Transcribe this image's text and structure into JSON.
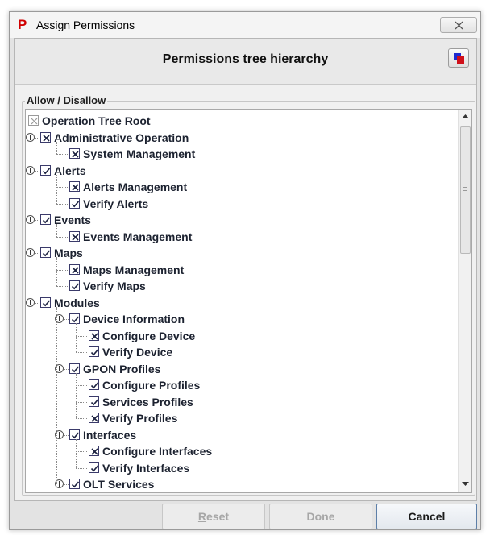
{
  "window": {
    "title": "Assign Permissions",
    "logo_letter": "P",
    "close_icon": "close-x-icon"
  },
  "header": {
    "title": "Permissions tree hierarchy",
    "icon": "windows-switch-icon"
  },
  "group": {
    "legend": "Allow / Disallow"
  },
  "tree": [
    {
      "label": "Operation Tree Root",
      "level": 0,
      "state": "root",
      "expandable": false
    },
    {
      "label": "Administrative Operation",
      "level": 1,
      "state": "x",
      "expandable": true
    },
    {
      "label": "System Management",
      "level": 2,
      "state": "x",
      "expandable": false
    },
    {
      "label": "Alerts",
      "level": 1,
      "state": "check",
      "expandable": true
    },
    {
      "label": "Alerts Management",
      "level": 2,
      "state": "x",
      "expandable": false
    },
    {
      "label": "Verify Alerts",
      "level": 2,
      "state": "check",
      "expandable": false
    },
    {
      "label": "Events",
      "level": 1,
      "state": "check",
      "expandable": true
    },
    {
      "label": "Events Management",
      "level": 2,
      "state": "x",
      "expandable": false
    },
    {
      "label": "Maps",
      "level": 1,
      "state": "check",
      "expandable": true
    },
    {
      "label": "Maps Management",
      "level": 2,
      "state": "x",
      "expandable": false
    },
    {
      "label": "Verify Maps",
      "level": 2,
      "state": "check",
      "expandable": false
    },
    {
      "label": "Modules",
      "level": 1,
      "state": "check",
      "expandable": true
    },
    {
      "label": "Device Information",
      "level": 2,
      "state": "check",
      "expandable": true
    },
    {
      "label": "Configure Device",
      "level": 3,
      "state": "x",
      "expandable": false
    },
    {
      "label": "Verify Device",
      "level": 3,
      "state": "check",
      "expandable": false
    },
    {
      "label": "GPON Profiles",
      "level": 2,
      "state": "check",
      "expandable": true
    },
    {
      "label": "Configure Profiles",
      "level": 3,
      "state": "check",
      "expandable": false
    },
    {
      "label": "Services Profiles",
      "level": 3,
      "state": "check",
      "expandable": false
    },
    {
      "label": "Verify Profiles",
      "level": 3,
      "state": "x",
      "expandable": false
    },
    {
      "label": "Interfaces",
      "level": 2,
      "state": "check",
      "expandable": true
    },
    {
      "label": "Configure Interfaces",
      "level": 3,
      "state": "x",
      "expandable": false
    },
    {
      "label": "Verify Interfaces",
      "level": 3,
      "state": "check",
      "expandable": false
    },
    {
      "label": "OLT Services",
      "level": 2,
      "state": "check",
      "expandable": true
    }
  ],
  "buttons": {
    "reset": "Reset",
    "done": "Done",
    "cancel": "Cancel"
  }
}
